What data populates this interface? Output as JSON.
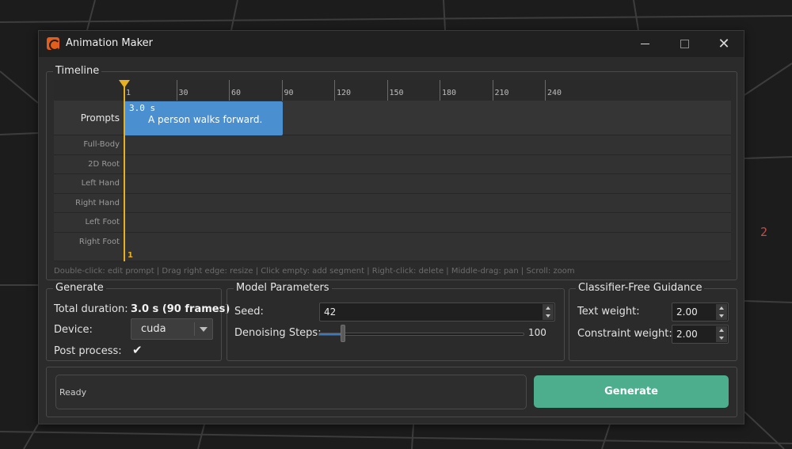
{
  "window": {
    "title": "Animation Maker",
    "minimize_icon": "minimize-icon",
    "maximize_icon": "maximize-icon",
    "close_glyph": "✕"
  },
  "viewport": {
    "axis_number": "2",
    "axis_color": "#c0504a"
  },
  "timeline": {
    "title": "Timeline",
    "ticks": [
      "1",
      "30",
      "60",
      "90",
      "120",
      "150",
      "180",
      "210",
      "240"
    ],
    "tracks": [
      "Prompts",
      "Full-Body",
      "2D Root",
      "Left Hand",
      "Right Hand",
      "Left Foot",
      "Right Foot"
    ],
    "segment": {
      "duration": "3.0 s",
      "text": "A person walks forward.",
      "color": "#4a8fd0"
    },
    "playhead": {
      "frame": "1",
      "color": "#e8b020"
    },
    "hint": "Double-click: edit prompt  |  Drag right edge: resize  |  Click empty: add segment  |  Right-click: delete  |  Middle-drag: pan  |  Scroll: zoom"
  },
  "generate_group": {
    "title": "Generate",
    "total_duration_label": "Total duration:",
    "total_duration_value": "3.0 s (90 frames)",
    "device_label": "Device:",
    "device_value": "cuda",
    "post_process_label": "Post process:",
    "post_process_checked": "✔"
  },
  "model_params": {
    "title": "Model Parameters",
    "seed_label": "Seed:",
    "seed_value": "42",
    "steps_label": "Denoising Steps:",
    "steps_max_label": "100",
    "steps_fraction": 0.12
  },
  "cfg": {
    "title": "Classifier-Free Guidance",
    "text_weight_label": "Text weight:",
    "text_weight_value": "2.00",
    "constraint_weight_label": "Constraint weight:",
    "constraint_weight_value": "2.00"
  },
  "bottom": {
    "status": "Ready",
    "generate_label": "Generate",
    "generate_color": "#4cae8c"
  }
}
